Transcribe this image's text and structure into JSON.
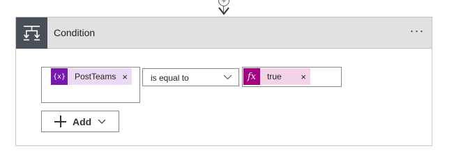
{
  "card": {
    "title": "Condition",
    "more_label": "···"
  },
  "condition": {
    "left_operand": {
      "token_type": "variable",
      "token_icon_text": "{x}",
      "token_label": "PostTeams",
      "remove_label": "×"
    },
    "operator": {
      "selected": "is equal to"
    },
    "right_operand": {
      "token_type": "expression",
      "token_icon_text": "fx",
      "token_label": "true",
      "remove_label": "×"
    }
  },
  "add_button": {
    "label": "Add"
  },
  "icons": {
    "connector_plus": "+",
    "condition_icon": "condition-branch-icon",
    "dropdown": "chevron-down-icon"
  },
  "colors": {
    "header_bg": "#e1e1e1",
    "header_icon_bg": "#484f58",
    "variable_token_bg": "#ecd9f5",
    "variable_icon_bg": "#7719aa",
    "expression_token_bg": "#f2d3e8",
    "expression_icon_bg": "#a4007f"
  }
}
